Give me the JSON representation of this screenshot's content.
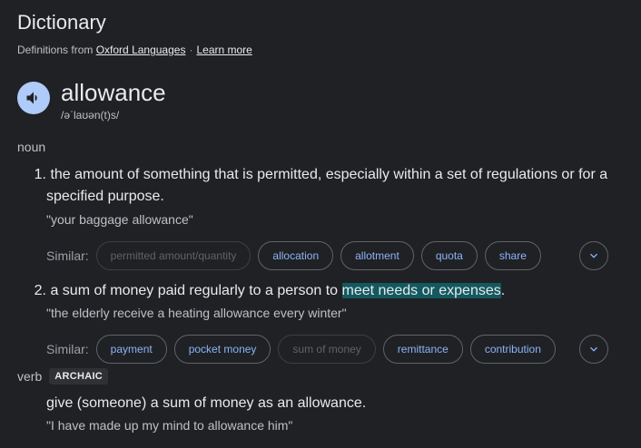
{
  "header": {
    "title": "Dictionary",
    "source_prefix": "Definitions from",
    "source_link": "Oxford Languages",
    "separator": "·",
    "learn_more": "Learn more"
  },
  "entry": {
    "word": "allowance",
    "phonetic": "/əˈlaʊən(t)s/",
    "speaker_icon": "volume-up-icon"
  },
  "noun": {
    "label": "noun",
    "senses": [
      {
        "number": "1.",
        "definition_line1": "the amount of something that is permitted, especially within a set of regulations or for a",
        "definition_line2": "specified purpose.",
        "example": "\"your baggage allowance\"",
        "similar_label": "Similar:",
        "similar": [
          {
            "label": "permitted amount/quantity",
            "enabled": false
          },
          {
            "label": "allocation",
            "enabled": true
          },
          {
            "label": "allotment",
            "enabled": true
          },
          {
            "label": "quota",
            "enabled": true
          },
          {
            "label": "share",
            "enabled": true
          }
        ]
      },
      {
        "number": "2.",
        "definition_before": "a sum of money paid regularly to a person to ",
        "definition_highlight": "meet needs or expenses",
        "definition_after": ".",
        "example": "\"the elderly receive a heating allowance every winter\"",
        "similar_label": "Similar:",
        "similar": [
          {
            "label": "payment",
            "enabled": true
          },
          {
            "label": "pocket money",
            "enabled": true
          },
          {
            "label": "sum of money",
            "enabled": false
          },
          {
            "label": "remittance",
            "enabled": true
          },
          {
            "label": "contribution",
            "enabled": true
          }
        ]
      }
    ]
  },
  "verb": {
    "label": "verb",
    "badge": "ARCHAIC",
    "definition": "give (someone) a sum of money as an allowance.",
    "example": "\"I have made up my mind to allowance him\""
  },
  "colors": {
    "background": "#202124",
    "text": "#e8eaed",
    "muted": "#bdc1c6",
    "chip_link": "#8ab4f8",
    "highlight": "#13595f",
    "speaker_bg": "#aecbfa"
  }
}
